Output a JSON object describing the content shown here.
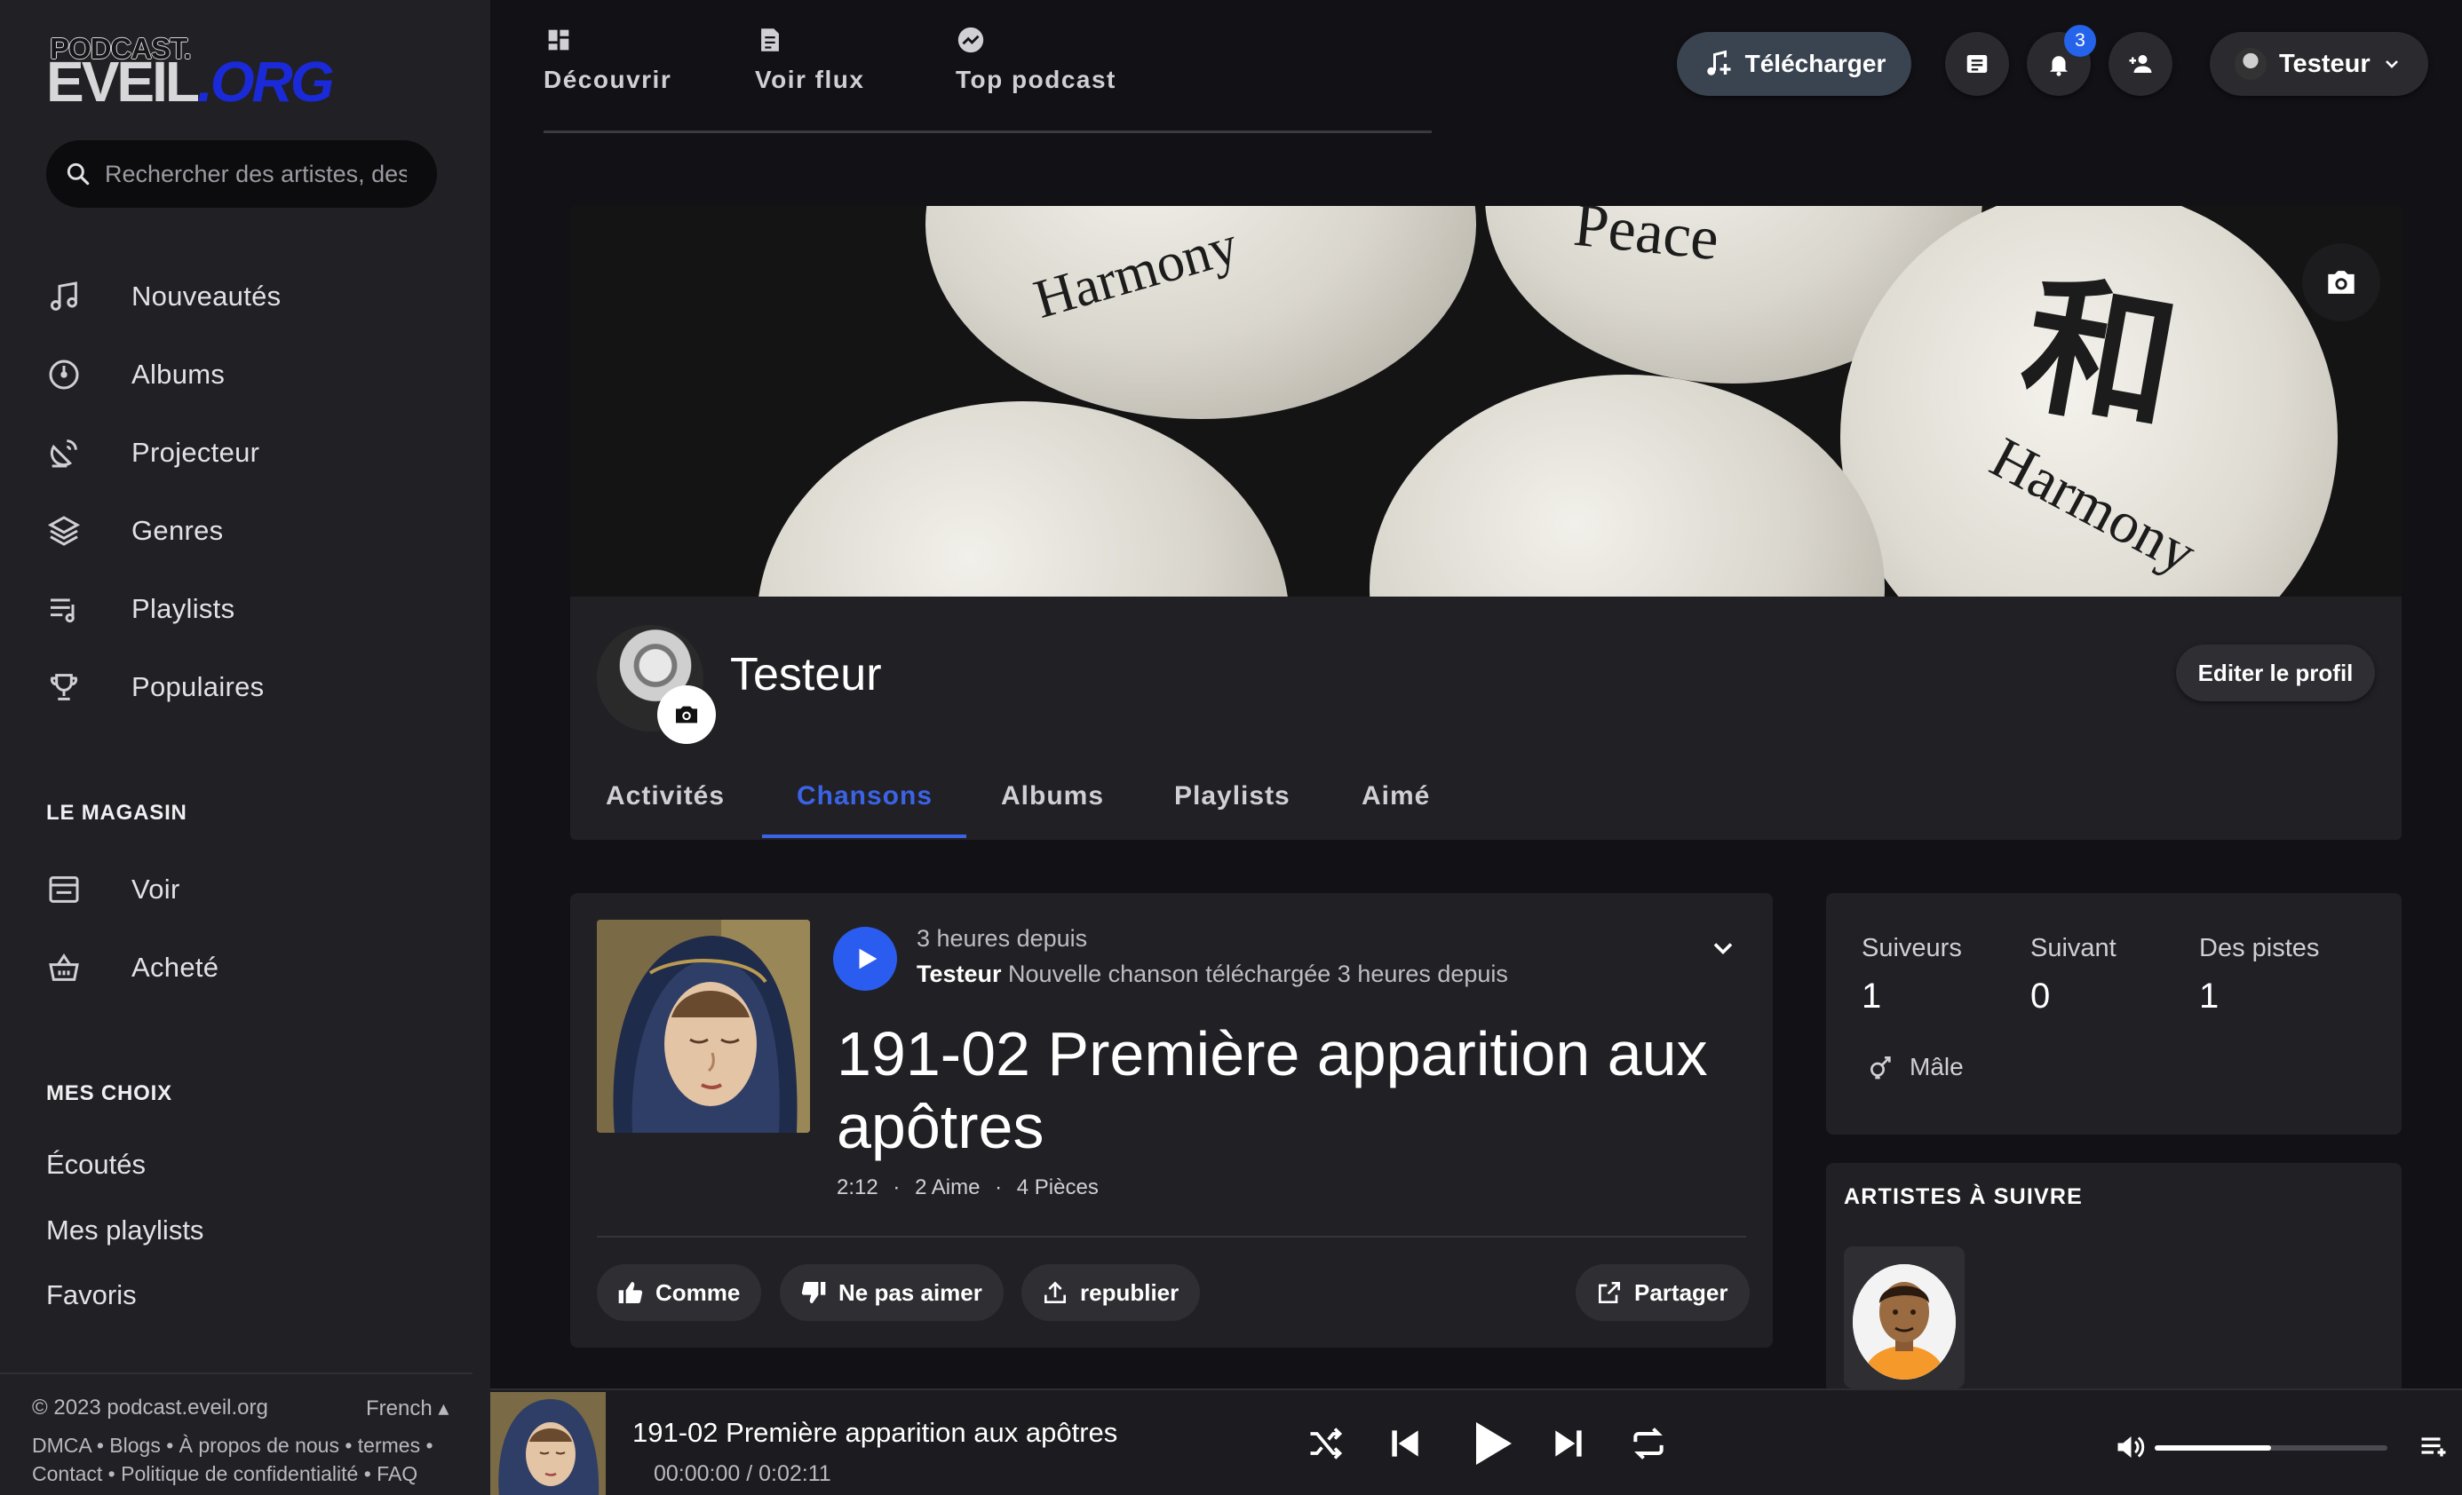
{
  "brand": {
    "line1": "PODCAST.",
    "line2a": "EVEIL",
    "line2b": ".ORG"
  },
  "search": {
    "placeholder": "Rechercher des artistes, des"
  },
  "sidebar": {
    "items": [
      {
        "label": "Nouveautés",
        "icon": "music-note-icon"
      },
      {
        "label": "Albums",
        "icon": "disc-icon"
      },
      {
        "label": "Projecteur",
        "icon": "satellite-dish-icon"
      },
      {
        "label": "Genres",
        "icon": "layers-icon"
      },
      {
        "label": "Playlists",
        "icon": "playlist-icon"
      },
      {
        "label": "Populaires",
        "icon": "trophy-icon"
      }
    ],
    "store_title": "LE MAGASIN",
    "store_items": [
      {
        "label": "Voir",
        "icon": "store-icon"
      },
      {
        "label": "Acheté",
        "icon": "basket-icon"
      }
    ],
    "choices_title": "MES CHOIX",
    "choices": [
      "Écoutés",
      "Mes playlists",
      "Favoris"
    ]
  },
  "footer": {
    "copyright": "© 2023 podcast.eveil.org",
    "language": "French",
    "links_line1": "DMCA • Blogs • À propos de nous • termes •",
    "links_line2": "Contact • Politique de confidentialité • FAQ"
  },
  "topnav": {
    "tabs": [
      {
        "label": "Découvrir",
        "icon": "dashboard-icon"
      },
      {
        "label": "Voir flux",
        "icon": "feed-icon"
      },
      {
        "label": "Top podcast",
        "icon": "trending-icon"
      }
    ],
    "upload_label": "Télécharger",
    "notifications_count": "3",
    "user_name": "Testeur"
  },
  "profile": {
    "name": "Testeur",
    "edit_label": "Editer le profil",
    "cover_words": [
      "Harmony",
      "Peace",
      "和",
      "Harmony"
    ],
    "tabs": [
      "Activités",
      "Chansons",
      "Albums",
      "Playlists",
      "Aimé"
    ],
    "active_tab": "Chansons"
  },
  "song": {
    "time_ago": "3 heures depuis",
    "user": "Testeur",
    "activity": "Nouvelle chanson téléchargée 3 heures depuis",
    "title": "191-02 Première apparition aux apôtres",
    "duration": "2:12",
    "likes": "2 Aime",
    "pieces": "4 Pièces",
    "like_label": "Comme",
    "dislike_label": "Ne pas aimer",
    "repost_label": "republier",
    "share_label": "Partager"
  },
  "stats": {
    "followers_label": "Suiveurs",
    "followers": "1",
    "following_label": "Suivant",
    "following": "0",
    "tracks_label": "Des pistes",
    "tracks": "1",
    "gender": "Mâle"
  },
  "follow": {
    "title": "ARTISTES À SUIVRE"
  },
  "player": {
    "title": "191-02 Première apparition aux apôtres",
    "time": "00:00:00 / 0:02:11",
    "volume_percent": 50
  },
  "colors": {
    "accent": "#3b63e6",
    "play": "#2b5cf0",
    "badge": "#2563eb"
  }
}
